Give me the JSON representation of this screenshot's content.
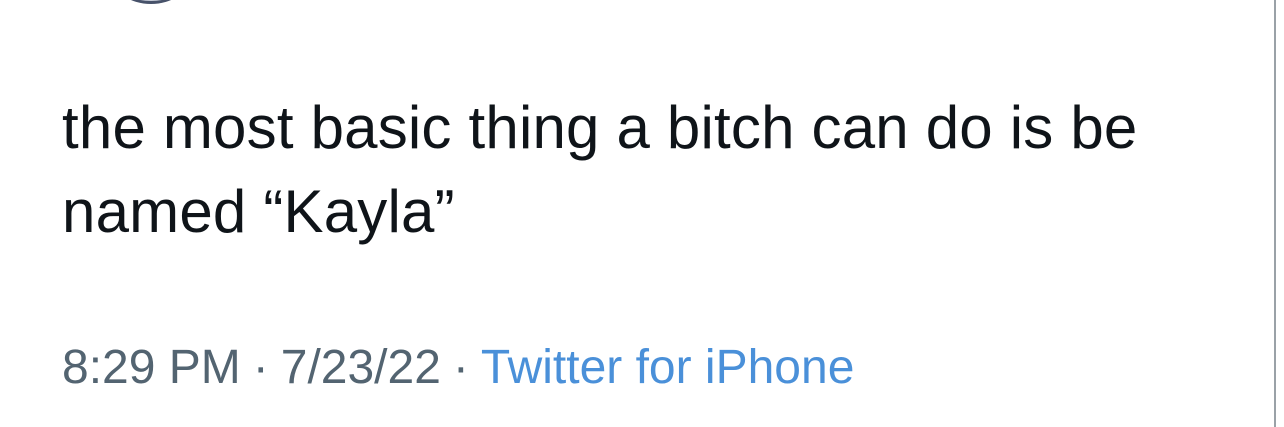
{
  "tweet": {
    "text": "the most basic thing a bitch can do is be named “Kayla”",
    "time": "8:29 PM",
    "separator": "·",
    "date": "7/23/22",
    "source": "Twitter for iPhone"
  }
}
